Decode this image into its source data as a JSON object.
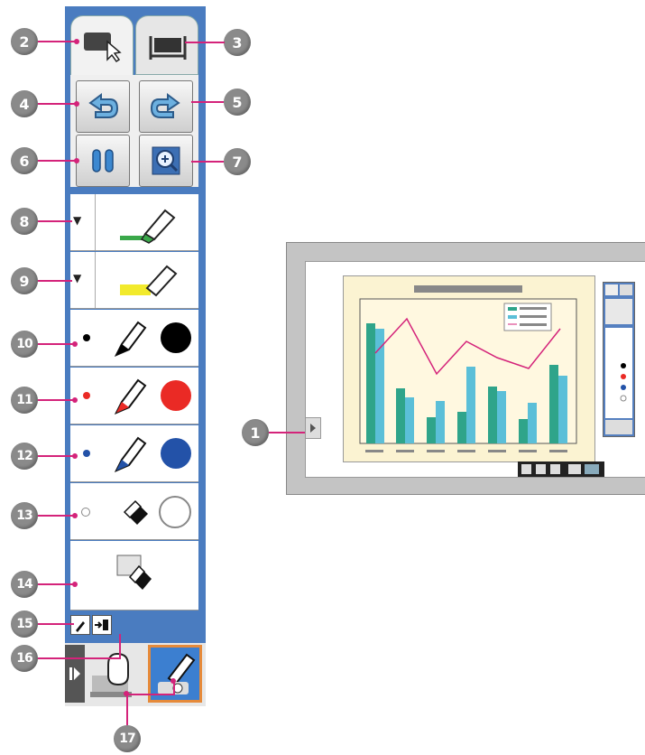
{
  "callouts": {
    "c1": "1",
    "c2": "2",
    "c3": "3",
    "c4": "4",
    "c5": "5",
    "c6": "6",
    "c7": "7",
    "c8": "8",
    "c9": "9",
    "c10": "10",
    "c11": "11",
    "c12": "12",
    "c13": "13",
    "c14": "14",
    "c15": "15",
    "c16": "16",
    "c17": "17"
  },
  "colors": {
    "leader": "#d4237a",
    "toolbar_bg": "#4a7cc0",
    "pen_black": "#000000",
    "pen_red": "#ea2a25",
    "pen_blue": "#2352a8",
    "highlighter_green": "#3aa84a",
    "highlighter_yellow": "#f2ea2c",
    "bar_teal": "#2fa48a",
    "bar_blue": "#5bbfd8",
    "line_red": "#d4237a",
    "slide_bg": "#fbf3d2"
  },
  "icons": {
    "tab_interactive": "monitor-cursor-icon",
    "tab_whiteboard": "whiteboard-icon",
    "undo": "undo-icon",
    "redo": "redo-icon",
    "pause": "pause-icon",
    "zoom": "zoom-in-icon",
    "pen": "pen-icon",
    "highlighter": "highlighter-icon",
    "eraser": "eraser-icon",
    "clear": "clear-screen-icon",
    "settings": "pen-settings-icon",
    "exit": "exit-icon",
    "mouse_mode": "mouse-mode-icon",
    "pen_mode": "pen-mode-icon",
    "expand": "expand-arrow-icon"
  }
}
